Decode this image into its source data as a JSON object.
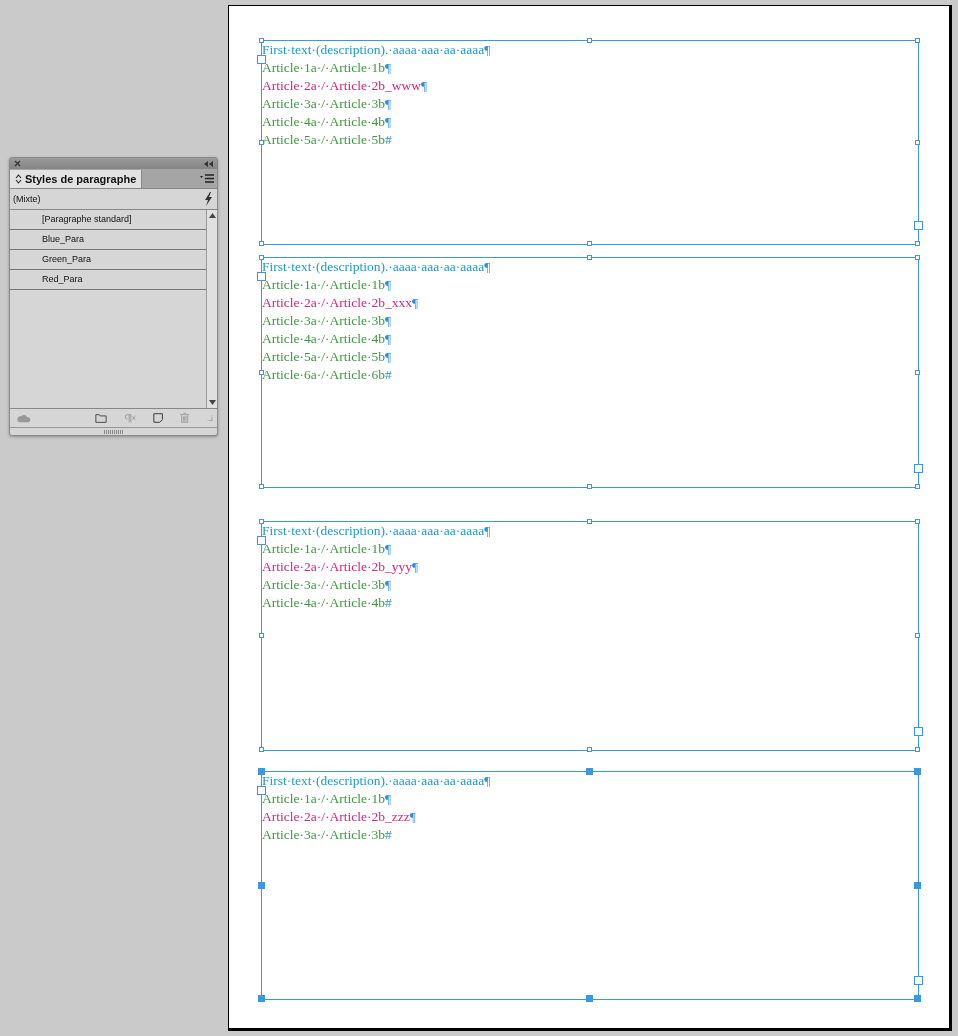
{
  "panel": {
    "tab": "Styles de paragraphe",
    "current_style": "(Mixte)",
    "styles": [
      {
        "label": "[Paragraphe standard]",
        "selected": false
      },
      {
        "label": "Blue_Para",
        "selected": false
      },
      {
        "label": "Green_Para",
        "selected": false
      },
      {
        "label": "Red_Para",
        "selected": false
      }
    ]
  },
  "frames": [
    {
      "selected": false,
      "lines": [
        {
          "text": "First·text·(description).·aaaa·aaa·aa·aaaa",
          "mark": "¶",
          "color": "#1b9bcf"
        },
        {
          "text": "Article·1a·/·Article·1b",
          "mark": "¶",
          "color": "#3d9a3d"
        },
        {
          "text": "Article·2a·/·Article·2b_www",
          "mark": "¶",
          "color": "#d42580"
        },
        {
          "text": "Article·3a·/·Article·3b",
          "mark": "¶",
          "color": "#3d9a3d"
        },
        {
          "text": "Article·4a·/·Article·4b",
          "mark": "¶",
          "color": "#3d9a3d"
        },
        {
          "text": "Article·5a·/·Article·5b",
          "mark": "#",
          "color": "#3d9a3d"
        }
      ]
    },
    {
      "selected": false,
      "lines": [
        {
          "text": "First·text·(description).·aaaa·aaa·aa·aaaa",
          "mark": "¶",
          "color": "#1b9bcf"
        },
        {
          "text": "Article·1a·/·Article·1b",
          "mark": "¶",
          "color": "#3d9a3d"
        },
        {
          "text": "Article·2a·/·Article·2b_xxx",
          "mark": "¶",
          "color": "#d42580"
        },
        {
          "text": "Article·3a·/·Article·3b",
          "mark": "¶",
          "color": "#3d9a3d"
        },
        {
          "text": "Article·4a·/·Article·4b",
          "mark": "¶",
          "color": "#3d9a3d"
        },
        {
          "text": "Article·5a·/·Article·5b",
          "mark": "¶",
          "color": "#3d9a3d"
        },
        {
          "text": "Article·6a·/·Article·6b",
          "mark": "#",
          "color": "#3d9a3d"
        }
      ]
    },
    {
      "selected": false,
      "lines": [
        {
          "text": "First·text·(description).·aaaa·aaa·aa·aaaa",
          "mark": "¶",
          "color": "#1b9bcf"
        },
        {
          "text": "Article·1a·/·Article·1b",
          "mark": "¶",
          "color": "#3d9a3d"
        },
        {
          "text": "Article·2a·/·Article·2b_yyy",
          "mark": "¶",
          "color": "#d42580"
        },
        {
          "text": "Article·3a·/·Article·3b",
          "mark": "¶",
          "color": "#3d9a3d"
        },
        {
          "text": "Article·4a·/·Article·4b",
          "mark": "#",
          "color": "#3d9a3d"
        }
      ]
    },
    {
      "selected": true,
      "lines": [
        {
          "text": "First·text·(description).·aaaa·aaa·aa·aaaa",
          "mark": "¶",
          "color": "#1b9bcf"
        },
        {
          "text": "Article·1a·/·Article·1b",
          "mark": "¶",
          "color": "#3d9a3d"
        },
        {
          "text": "Article·2a·/·Article·2b_zzz",
          "mark": "¶",
          "color": "#d42580"
        },
        {
          "text": "Article·3a·/·Article·3b",
          "mark": "#",
          "color": "#3d9a3d"
        }
      ]
    }
  ]
}
